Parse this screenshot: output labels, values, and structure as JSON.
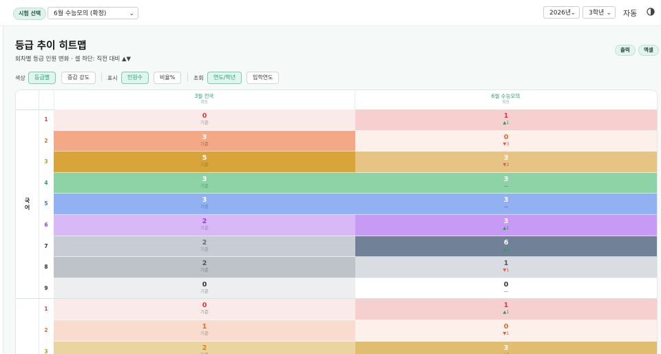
{
  "topbar": {
    "exam_chip": "시험 선택",
    "exam_select": "6월 수능모의 (확정)",
    "year_select": "2026년",
    "grade_select": "3학년",
    "auto_label": "자동"
  },
  "header": {
    "title": "등급 추이 히트맵",
    "subtitle": "회차별 등급 인원 변화 · 셀 하단: 직전 대비 ▲▼",
    "print_label": "출력",
    "excel_label": "엑셀"
  },
  "controls": {
    "color_label": "색상",
    "color_grade": "등급별",
    "color_delta": "증감 강도",
    "display_label": "표시",
    "display_count": "인원수",
    "display_ratio": "비율%",
    "view_label": "조회",
    "view_year": "연도/학년",
    "view_entry": "입학연도"
  },
  "colors": {
    "accent": "#1f9a77",
    "up": "#2e9e5b",
    "down": "#e05a4f"
  },
  "table": {
    "columns": [
      {
        "name": "3월 전국",
        "status": "확정"
      },
      {
        "name": "6월 수능모의",
        "status": "확정"
      }
    ],
    "subjects": [
      {
        "name": "국\n어",
        "rows": [
          {
            "grade": "1",
            "gradeColor": "#d93b3b",
            "c1": {
              "v": "0",
              "s": "기준",
              "bg": "#fbeaea",
              "fg": "#d93b3b",
              "sc": "#9a9a9a"
            },
            "c2": {
              "v": "1",
              "s": "▲1",
              "bg": "#f6d0cf",
              "fg": "#d93b3b",
              "sc": "#2e9e5b"
            }
          },
          {
            "grade": "2",
            "gradeColor": "#e06b2c",
            "c1": {
              "v": "3",
              "s": "기준",
              "bg": "#f4a986",
              "fg": "#ffffff",
              "sc": "#9a6b55"
            },
            "c2": {
              "v": "0",
              "s": "▼3",
              "bg": "#fdf0ea",
              "fg": "#e06b2c",
              "sc": "#e05a4f"
            }
          },
          {
            "grade": "3",
            "gradeColor": "#c98d12",
            "c1": {
              "v": "5",
              "s": "기준",
              "bg": "#d8a53b",
              "fg": "#ffffff",
              "sc": "#a07a2c"
            },
            "c2": {
              "v": "3",
              "s": "▼2",
              "bg": "#e5c484",
              "fg": "#ffffff",
              "sc": "#e05a4f"
            }
          },
          {
            "grade": "4",
            "gradeColor": "#2e9e5b",
            "c1": {
              "v": "3",
              "s": "기준",
              "bg": "#8ed3a6",
              "fg": "#ffffff",
              "sc": "#5c9b73"
            },
            "c2": {
              "v": "3",
              "s": "—",
              "bg": "#8ed3a6",
              "fg": "#ffffff",
              "sc": "#2f6b46"
            }
          },
          {
            "grade": "5",
            "gradeColor": "#3b6fe0",
            "c1": {
              "v": "3",
              "s": "기준",
              "bg": "#92b1f2",
              "fg": "#ffffff",
              "sc": "#5f7fc0"
            },
            "c2": {
              "v": "3",
              "s": "—",
              "bg": "#92b1f2",
              "fg": "#ffffff",
              "sc": "#2c4d93"
            }
          },
          {
            "grade": "6",
            "gradeColor": "#8f3fe0",
            "c1": {
              "v": "2",
              "s": "기준",
              "bg": "#d8b8f6",
              "fg": "#8f3fe0",
              "sc": "#9a86b3"
            },
            "c2": {
              "v": "3",
              "s": "▲1",
              "bg": "#c79af3",
              "fg": "#ffffff",
              "sc": "#2e9e5b"
            }
          },
          {
            "grade": "7",
            "gradeColor": "#333333",
            "c1": {
              "v": "2",
              "s": "기준",
              "bg": "#c8cdd5",
              "fg": "#666c76",
              "sc": "#8a8f97"
            },
            "c2": {
              "v": "6",
              "s": "▲4",
              "bg": "#708198",
              "fg": "#ffffff",
              "sc": "#2e9e5b"
            }
          },
          {
            "grade": "8",
            "gradeColor": "#333333",
            "c1": {
              "v": "2",
              "s": "기준",
              "bg": "#bec2c9",
              "fg": "#4f545b",
              "sc": "#7d8187"
            },
            "c2": {
              "v": "1",
              "s": "▼1",
              "bg": "#d9dce0",
              "fg": "#4f545b",
              "sc": "#e05a4f"
            }
          },
          {
            "grade": "9",
            "gradeColor": "#333333",
            "c1": {
              "v": "0",
              "s": "기준",
              "bg": "#eceef0",
              "fg": "#333333",
              "sc": "#9a9a9a"
            },
            "c2": {
              "v": "0",
              "s": "—",
              "bg": "#ffffff",
              "fg": "#333333",
              "sc": "#555555"
            }
          }
        ]
      },
      {
        "name": "",
        "rows": [
          {
            "grade": "1",
            "gradeColor": "#d93b3b",
            "c1": {
              "v": "0",
              "s": "기준",
              "bg": "#fbeaea",
              "fg": "#d93b3b",
              "sc": "#9a9a9a"
            },
            "c2": {
              "v": "1",
              "s": "▲1",
              "bg": "#f6d0cf",
              "fg": "#d93b3b",
              "sc": "#2e9e5b"
            }
          },
          {
            "grade": "2",
            "gradeColor": "#e06b2c",
            "c1": {
              "v": "1",
              "s": "기준",
              "bg": "#f9dccd",
              "fg": "#e06b2c",
              "sc": "#9a9a9a"
            },
            "c2": {
              "v": "0",
              "s": "▼1",
              "bg": "#fdf0ea",
              "fg": "#e06b2c",
              "sc": "#e05a4f"
            }
          },
          {
            "grade": "3",
            "gradeColor": "#c98d12",
            "c1": {
              "v": "2",
              "s": "기준",
              "bg": "#ead49f",
              "fg": "#c98d12",
              "sc": "#9a9a9a"
            },
            "c2": {
              "v": "3",
              "s": "▲1",
              "bg": "#e0bd6f",
              "fg": "#ffffff",
              "sc": "#2e9e5b"
            }
          }
        ]
      }
    ]
  }
}
